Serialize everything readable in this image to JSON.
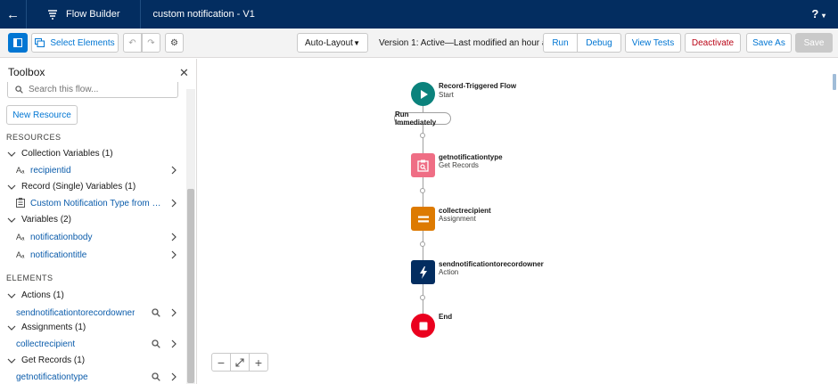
{
  "header": {
    "app_name": "Flow Builder",
    "flow_name": "custom notification - V1",
    "help_label": "?"
  },
  "toolbar": {
    "select_elements": "Select Elements",
    "layout_option": "Auto-Layout",
    "version_text": "Version 1: Active—Last modified an hour ago",
    "run": "Run",
    "debug": "Debug",
    "view_tests": "View Tests",
    "deactivate": "Deactivate",
    "save_as": "Save As",
    "save": "Save"
  },
  "toolbox": {
    "title": "Toolbox",
    "search_placeholder": "Search this flow...",
    "new_resource": "New Resource",
    "resources_heading": "RESOURCES",
    "elements_heading": "ELEMENTS",
    "groups": {
      "collection_vars": "Collection Variables (1)",
      "record_vars": "Record (Single) Variables (1)",
      "variables": "Variables (2)",
      "actions": "Actions (1)",
      "assignments": "Assignments (1)",
      "get_records": "Get Records (1)"
    },
    "items": {
      "recipientid": "recipientid",
      "custom_notification_type": "Custom Notification Type from getn...",
      "notificationbody": "notificationbody",
      "notificationtitle": "notificationtitle",
      "sendnotification": "sendnotificationtorecordowner",
      "collectrecipient": "collectrecipient",
      "getnotificationtype": "getnotificationtype"
    },
    "text_icon": "Aₐ"
  },
  "canvas": {
    "start": {
      "title": "Record-Triggered Flow",
      "subtitle": "Start"
    },
    "run_pill": "Run Immediately",
    "get_records": {
      "title": "getnotificationtype",
      "subtitle": "Get Records"
    },
    "assignment": {
      "title": "collectrecipient",
      "subtitle": "Assignment"
    },
    "action": {
      "title": "sendnotificationtorecordowner",
      "subtitle": "Action"
    },
    "end": {
      "title": "End"
    },
    "zoom_out": "−",
    "zoom_in": "+"
  },
  "colors": {
    "header_bg": "#032d60",
    "brand": "#0176d3",
    "start_node": "#0b827c",
    "get_records_node": "#ef6e85",
    "assignment_node": "#dd7a01",
    "action_node": "#032d60",
    "end_node": "#ea001e"
  }
}
